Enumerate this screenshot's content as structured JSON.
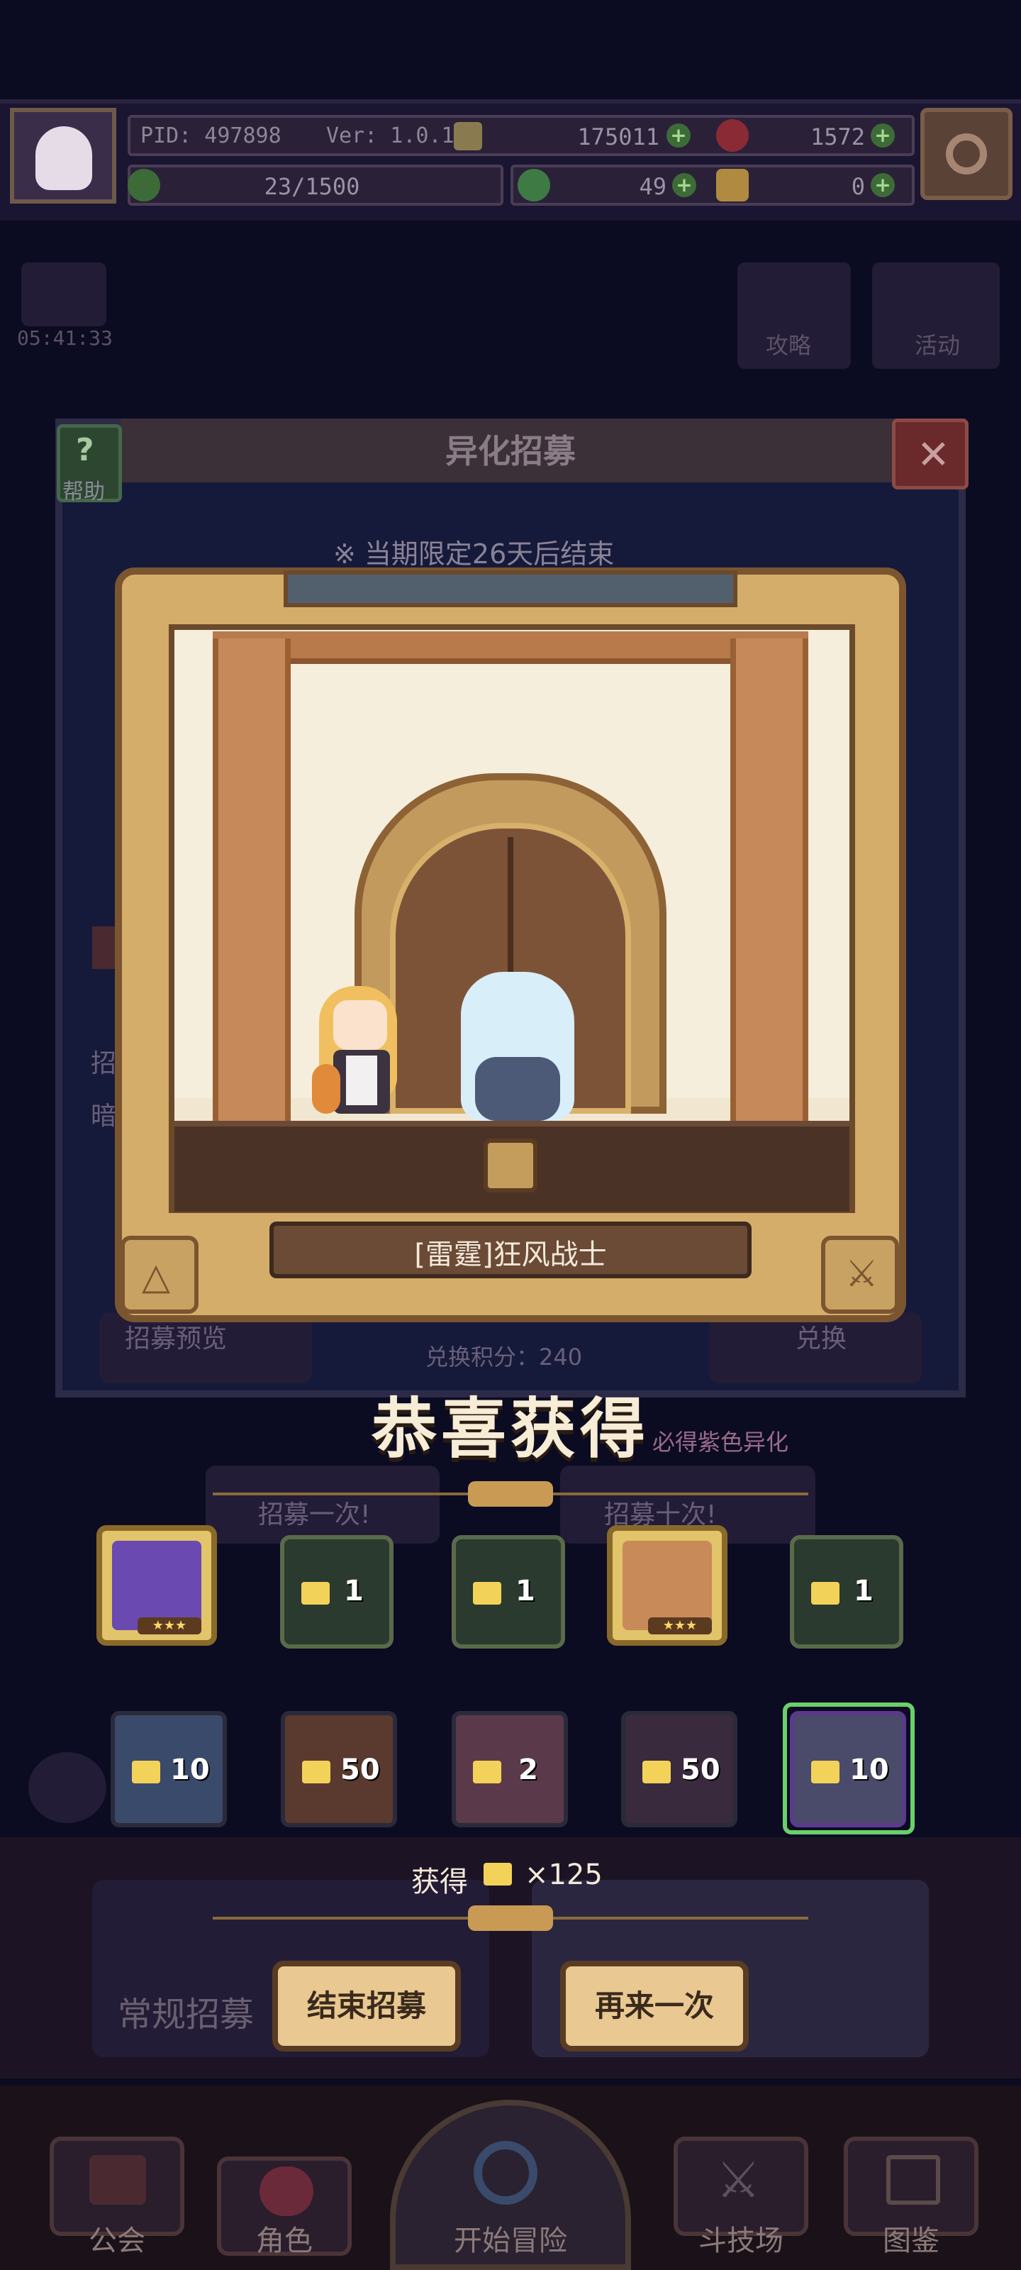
{
  "status": {
    "pid": "PID: 497898",
    "version": "Ver: 1.0.1.4",
    "gold": "175011",
    "gems": "1572",
    "stamina": "23/1500",
    "clover": "49",
    "food": "0"
  },
  "background": {
    "timer": "05:41:33",
    "guide_label": "攻略",
    "event_label": "活动",
    "panel_title": "异化招募",
    "help_label": "帮助",
    "limited_notice": "※ 当期限定26天后结束",
    "recruit_preview": "招募预览",
    "exchange": "兑换",
    "exchange_points": "兑换积分：240",
    "purple_guarantee": "必得紫色异化",
    "recruit_once": "招募一次!",
    "recruit_ten": "招募十次!",
    "normal_recruit": "常规招募"
  },
  "popup": {
    "character_name": "[雷霆]狂风战士"
  },
  "result": {
    "title": "恭喜获得",
    "row1": [
      {
        "type": "hero",
        "stars": "★★★",
        "color": "#6a4ab0"
      },
      {
        "type": "chest",
        "count": "1",
        "color": "#2a3a2e"
      },
      {
        "type": "chest",
        "count": "1",
        "color": "#2a3a2e"
      },
      {
        "type": "hero",
        "stars": "★★★",
        "color": "#c88a58"
      },
      {
        "type": "chest",
        "count": "1",
        "color": "#2a3a2e"
      }
    ],
    "row2": [
      {
        "count": "10",
        "color": "#3a4a6a"
      },
      {
        "count": "50",
        "color": "#5a3a2e"
      },
      {
        "count": "2",
        "color": "#5a3a4a"
      },
      {
        "count": "50",
        "color": "#3a2a3e"
      },
      {
        "count": "10",
        "color": "#4a4a6a"
      }
    ],
    "obtain_prefix": "获得",
    "obtain_amount": "×125",
    "end_button": "结束招募",
    "again_button": "再来一次"
  },
  "nav": {
    "guild": "公会",
    "character": "角色",
    "adventure": "开始冒险",
    "arena": "斗技场",
    "codex": "图鉴"
  }
}
